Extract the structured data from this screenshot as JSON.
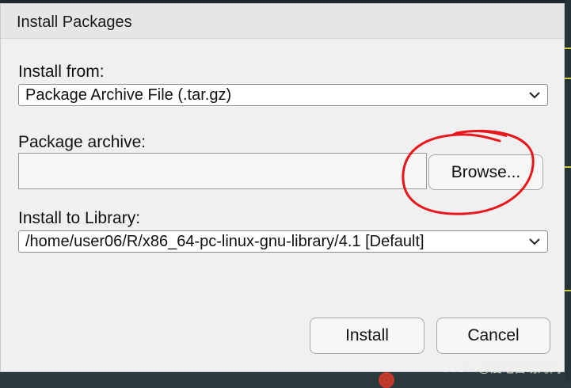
{
  "dialog": {
    "title": "Install Packages",
    "install_from": {
      "label": "Install from:",
      "selected": "Package Archive File (.tar.gz)"
    },
    "package_archive": {
      "label": "Package archive:",
      "value": "",
      "browse_label": "Browse..."
    },
    "install_to_library": {
      "label": "Install to Library:",
      "selected": "/home/user06/R/x86_64-pc-linux-gnu-library/4.1 [Default]"
    },
    "buttons": {
      "install_label": "Install",
      "cancel_label": "Cancel"
    }
  },
  "annotation": {
    "color": "#e8161b",
    "shape": "hand-drawn-circle"
  },
  "watermark": {
    "text": "CSDN @爱吃自助烤肉"
  },
  "colors": {
    "dialog_bg": "#f0f0f0",
    "titlebar_bg": "#e6e6e6",
    "field_border": "#8c8c8c"
  }
}
